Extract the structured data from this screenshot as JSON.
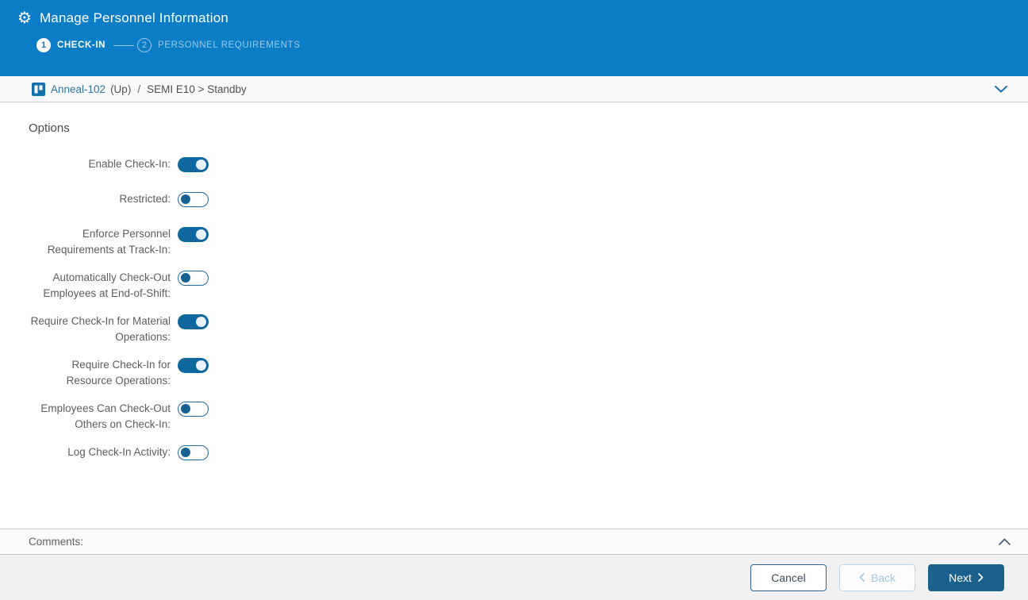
{
  "header": {
    "title": "Manage Personnel Information",
    "steps": [
      {
        "number": "1",
        "label": "CHECK-IN",
        "active": true
      },
      {
        "number": "2",
        "label": "PERSONNEL REQUIREMENTS",
        "active": false
      }
    ]
  },
  "resource_bar": {
    "name": "Anneal-102",
    "status": "(Up)",
    "separator": "/",
    "state_path": "SEMI E10 > Standby"
  },
  "options": {
    "heading": "Options",
    "toggles": [
      {
        "label": "Enable Check-In:",
        "on": true
      },
      {
        "label": "Restricted:",
        "on": false
      },
      {
        "label": "Enforce Personnel Requirements at Track-In:",
        "on": true
      },
      {
        "label": "Automatically Check-Out Employees at End-of-Shift:",
        "on": false
      },
      {
        "label": "Require Check-In for Material Operations:",
        "on": true
      },
      {
        "label": "Require Check-In for Resource Operations:",
        "on": true
      },
      {
        "label": "Employees Can Check-Out Others on Check-In:",
        "on": false
      },
      {
        "label": "Log Check-In Activity:",
        "on": false
      }
    ]
  },
  "comments": {
    "label": "Comments:"
  },
  "footer": {
    "cancel_label": "Cancel",
    "back_label": "Back",
    "next_label": "Next"
  },
  "colors": {
    "header_blue": "#0b7dc6",
    "toggle_on": "#0e689e",
    "next_button": "#19618c",
    "link_blue": "#2a74a8",
    "step_inactive": "#9cc8e8",
    "label_gray": "#5d5d5d",
    "border_gray": "#cccccc"
  }
}
